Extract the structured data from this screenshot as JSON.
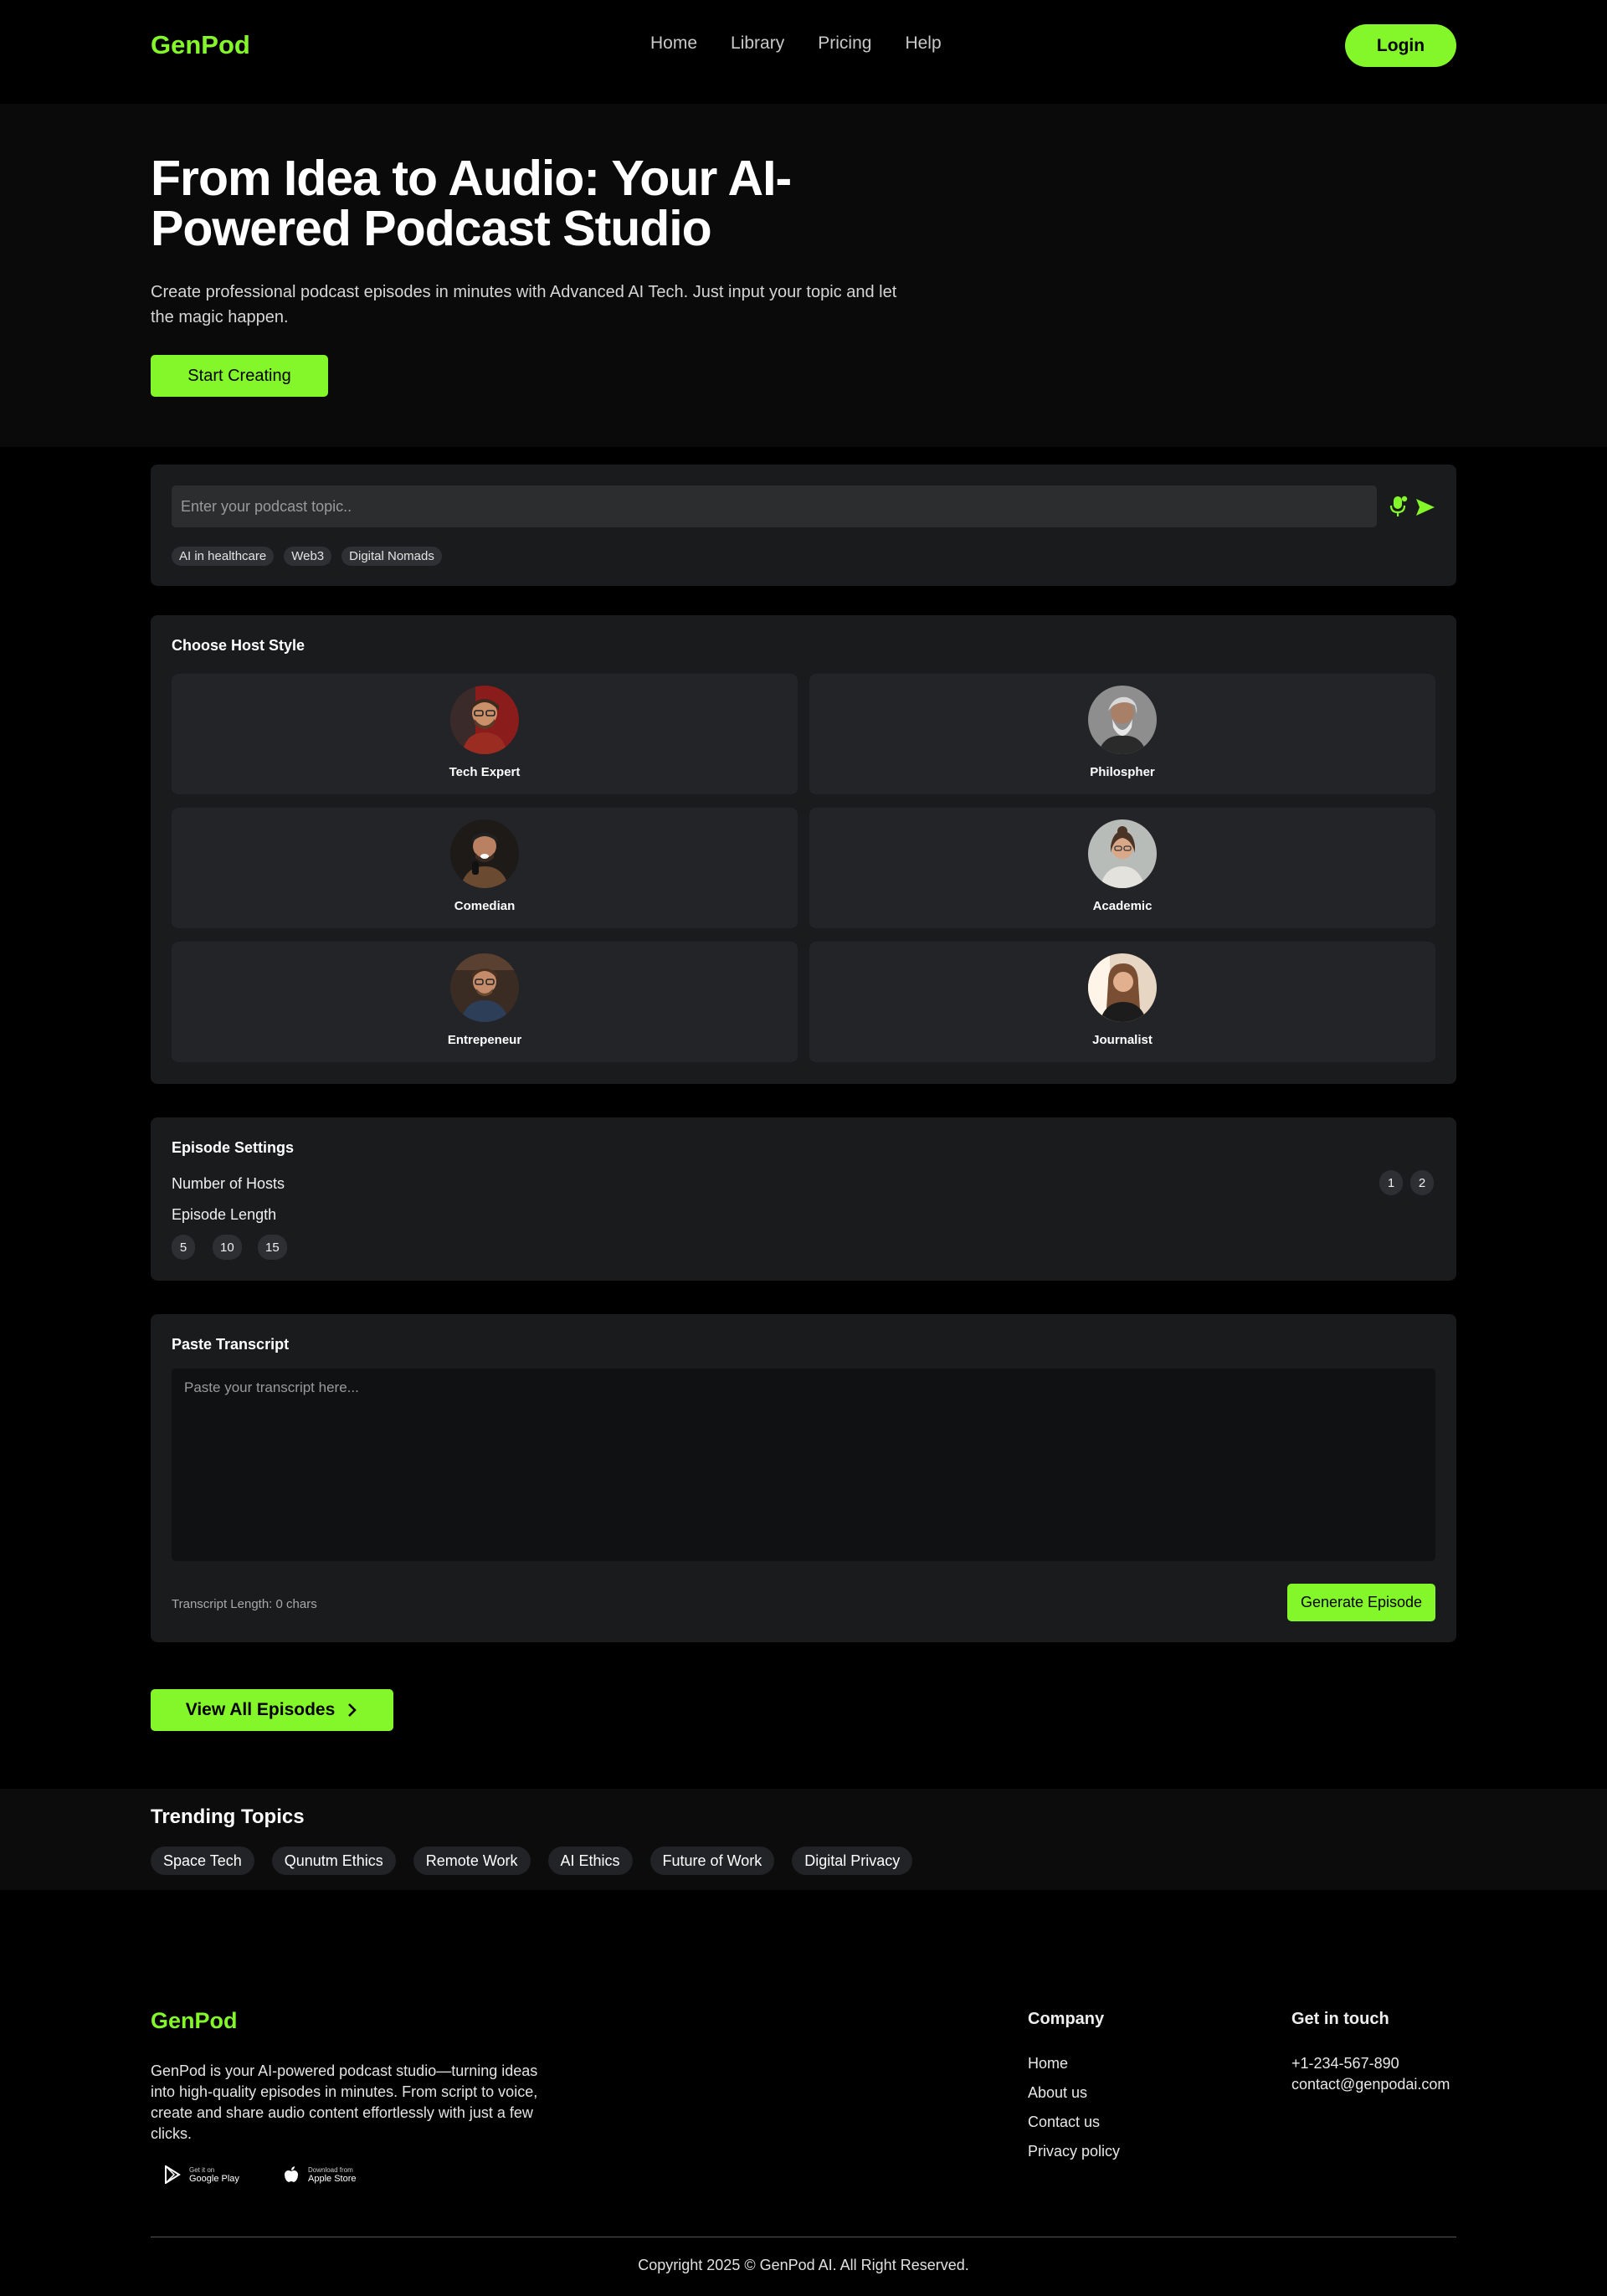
{
  "nav": {
    "logo": "GenPod",
    "links": [
      "Home",
      "Library",
      "Pricing",
      "Help"
    ],
    "login": "Login"
  },
  "hero": {
    "title": "From Idea to Audio: Your AI-Powered Podcast Studio",
    "subtitle": "Create professional podcast episodes in minutes with Advanced AI Tech. Just input your topic and let the magic happen.",
    "cta": "Start Creating"
  },
  "topic": {
    "placeholder": "Enter your podcast topic..",
    "suggestions": [
      "AI in healthcare",
      "Web3",
      "Digital Nomads"
    ]
  },
  "hosts": {
    "title": "Choose Host Style",
    "items": [
      {
        "name": "Tech Expert"
      },
      {
        "name": "Philospher"
      },
      {
        "name": "Comedian"
      },
      {
        "name": "Academic"
      },
      {
        "name": "Entrepeneur"
      },
      {
        "name": "Journalist"
      }
    ]
  },
  "settings": {
    "title": "Episode Settings",
    "hosts_label": "Number of Hosts",
    "hosts_options": [
      "1",
      "2"
    ],
    "length_label": "Episode Length",
    "length_options": [
      "5",
      "10",
      "15"
    ]
  },
  "transcript": {
    "title": "Paste Transcript",
    "placeholder": "Paste your transcript here...",
    "length": "Transcript Length: 0 chars",
    "generate": "Generate Episode"
  },
  "view_all": "View All Episodes",
  "trending": {
    "title": "Trending Topics",
    "topics": [
      "Space Tech",
      "Qunutm Ethics",
      "Remote Work",
      "AI Ethics",
      "Future of Work",
      "Digital Privacy"
    ]
  },
  "footer": {
    "logo": "GenPod",
    "description": "GenPod is your AI-powered podcast studio—turning ideas into high-quality episodes in minutes. From script to voice, create and share audio content effortlessly with just a few clicks.",
    "stores": {
      "google_small": "Get it on",
      "google_big": "Google Play",
      "apple_small": "Download from",
      "apple_big": "Apple Store"
    },
    "company_title": "Company",
    "company_links": [
      "Home",
      "About us",
      "Contact us",
      "Privacy policy"
    ],
    "contact_title": "Get in touch",
    "phone": "+1-234-567-890",
    "email": "contact@genpodai.com",
    "copyright": "Copyright 2025 © GenPod AI. All Right Reserved."
  },
  "colors": {
    "accent": "#84f72a",
    "background": "#000000",
    "card": "#1a1b1d"
  }
}
